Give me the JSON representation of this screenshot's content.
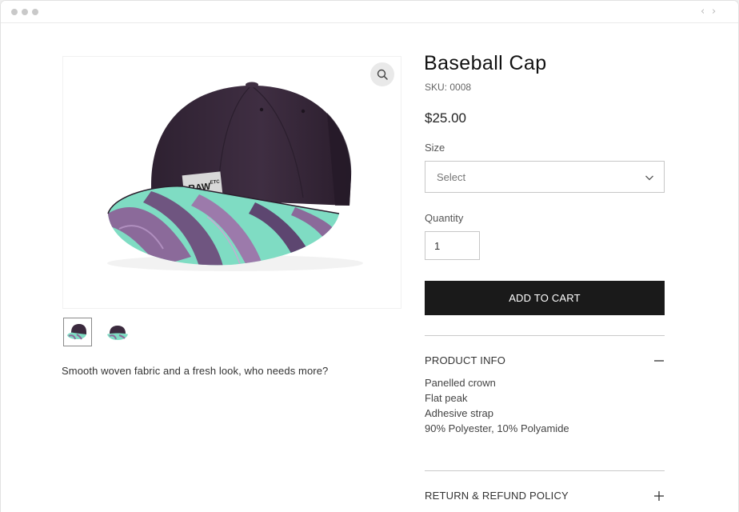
{
  "browser": {
    "icons": [
      "window-dot-icon",
      "chevron-left-icon",
      "chevron-right-icon"
    ]
  },
  "gallery": {
    "zoom_icon": "magnifier-icon",
    "thumbnails": [
      "cap-thumb-1",
      "cap-thumb-2"
    ],
    "selected_thumb": 0
  },
  "product": {
    "title": "Baseball Cap",
    "sku": "SKU: 0008",
    "price": "$25.00",
    "description": "Smooth woven fabric and a fresh look, who needs more?",
    "logo_text": "RAW",
    "logo_sub": "ETC"
  },
  "options": {
    "size_label": "Size",
    "size_value": "Select",
    "quantity_label": "Quantity",
    "quantity_value": "1"
  },
  "cart": {
    "add_label": "ADD TO CART"
  },
  "sections": {
    "info_title": "PRODUCT INFO",
    "info_lines": [
      "Panelled crown",
      "Flat peak",
      "Adhesive strap",
      "90% Polyester, 10% Polyamide"
    ],
    "return_title": "RETURN & REFUND POLICY"
  },
  "colors": {
    "accent": "#1a1a1a",
    "cap_crown": "#3b2a3e",
    "brim_mint": "#7fdcc3",
    "brim_purple": "#8b6a9a"
  }
}
